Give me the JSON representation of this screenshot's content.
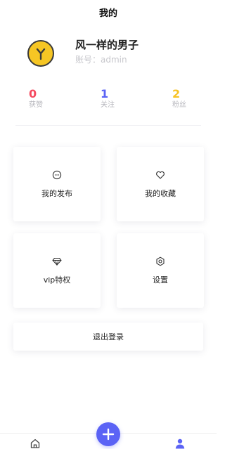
{
  "header": {
    "title": "我的"
  },
  "profile": {
    "nickname": "风一样的男子",
    "account": "账号：admin",
    "avatar_icon": "tree-logo-icon"
  },
  "stats": [
    {
      "value": "0",
      "label": "获赞",
      "color": "#f5495f"
    },
    {
      "value": "1",
      "label": "关注",
      "color": "#5b63f5"
    },
    {
      "value": "2",
      "label": "粉丝",
      "color": "#f7c325"
    }
  ],
  "menu": [
    {
      "label": "我的发布",
      "icon": "chat-bubble-icon"
    },
    {
      "label": "我的收藏",
      "icon": "heart-icon"
    },
    {
      "label": "vip特权",
      "icon": "diamond-icon"
    },
    {
      "label": "设置",
      "icon": "settings-hexagon-icon"
    }
  ],
  "logout": {
    "label": "退出登录"
  },
  "tabbar": {
    "items": [
      {
        "name": "home",
        "icon": "home-icon"
      },
      {
        "name": "add",
        "icon": "plus-icon",
        "color": "#5b63f5"
      },
      {
        "name": "me",
        "icon": "user-icon",
        "color": "#5b63f5"
      }
    ]
  }
}
